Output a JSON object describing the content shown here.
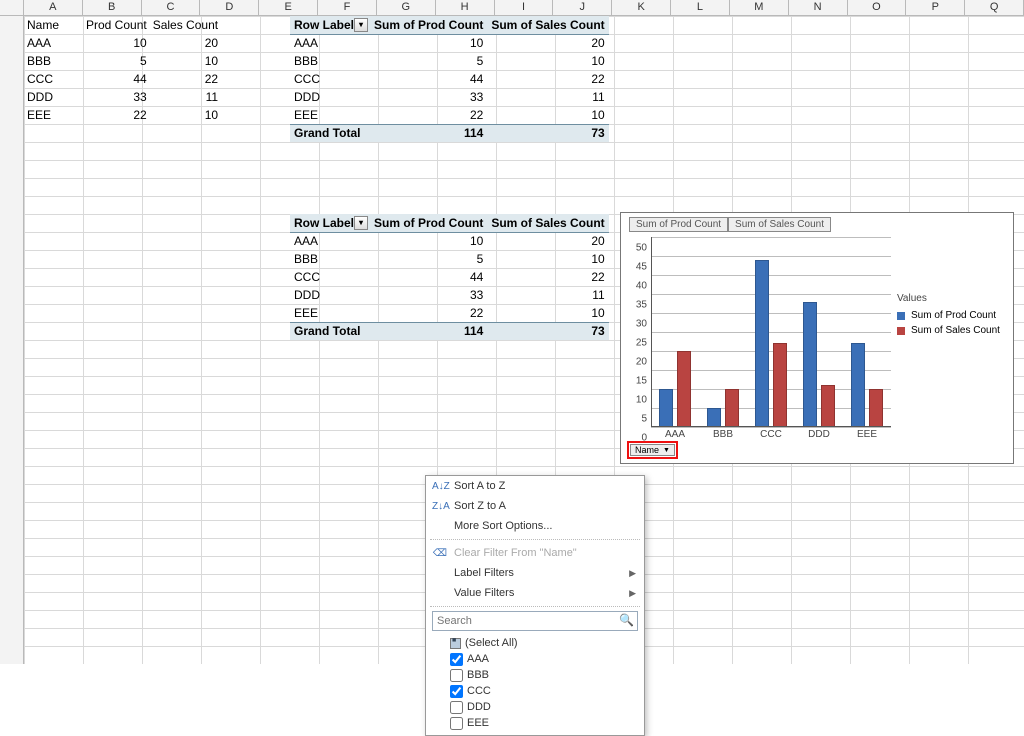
{
  "columns": [
    "A",
    "B",
    "C",
    "D",
    "E",
    "F",
    "G",
    "H",
    "I",
    "J",
    "K",
    "L",
    "M",
    "N",
    "O",
    "P",
    "Q"
  ],
  "raw": {
    "headers": [
      "Name",
      "Prod Count",
      "Sales Count"
    ],
    "rows": [
      {
        "name": "AAA",
        "prod": 10,
        "sales": 20
      },
      {
        "name": "BBB",
        "prod": 5,
        "sales": 10
      },
      {
        "name": "CCC",
        "prod": 44,
        "sales": 22
      },
      {
        "name": "DDD",
        "prod": 33,
        "sales": 11
      },
      {
        "name": "EEE",
        "prod": 22,
        "sales": 10
      }
    ]
  },
  "pivot": {
    "row_labels_label": "Row Labels",
    "col1": "Sum of Prod Count",
    "col2": "Sum of Sales Count",
    "rows": [
      {
        "name": "AAA",
        "prod": 10,
        "sales": 20
      },
      {
        "name": "BBB",
        "prod": 5,
        "sales": 10
      },
      {
        "name": "CCC",
        "prod": 44,
        "sales": 22
      },
      {
        "name": "DDD",
        "prod": 33,
        "sales": 11
      },
      {
        "name": "EEE",
        "prod": 22,
        "sales": 10
      }
    ],
    "grand_label": "Grand Total",
    "grand_prod": 114,
    "grand_sales": 73
  },
  "ctx_menu": {
    "sort_az": "Sort A to Z",
    "sort_za": "Sort Z to A",
    "more_sort": "More Sort Options...",
    "clear_filter": "Clear Filter From \"Name\"",
    "label_filters": "Label Filters",
    "value_filters": "Value Filters",
    "search_placeholder": "Search",
    "select_all": "(Select All)",
    "options": [
      {
        "label": "AAA",
        "checked": true
      },
      {
        "label": "BBB",
        "checked": false
      },
      {
        "label": "CCC",
        "checked": true
      },
      {
        "label": "DDD",
        "checked": false
      },
      {
        "label": "EEE",
        "checked": false
      }
    ],
    "icon_az": "A↓Z",
    "icon_za": "Z↓A",
    "icon_clear": "⌫"
  },
  "chart_ui": {
    "field_prod": "Sum of Prod Count",
    "field_sales": "Sum of Sales Count",
    "legend_title": "Values",
    "legend_prod": "Sum of Prod Count",
    "legend_sales": "Sum of Sales Count",
    "name_btn": "Name"
  },
  "chart_data": {
    "type": "bar",
    "categories": [
      "AAA",
      "BBB",
      "CCC",
      "DDD",
      "EEE"
    ],
    "series": [
      {
        "name": "Sum of Prod Count",
        "values": [
          10,
          5,
          44,
          33,
          22
        ]
      },
      {
        "name": "Sum of Sales Count",
        "values": [
          20,
          10,
          22,
          11,
          10
        ]
      }
    ],
    "ylim": [
      0,
      50
    ],
    "ytick": 5,
    "xlabel": "",
    "ylabel": "",
    "title": ""
  }
}
